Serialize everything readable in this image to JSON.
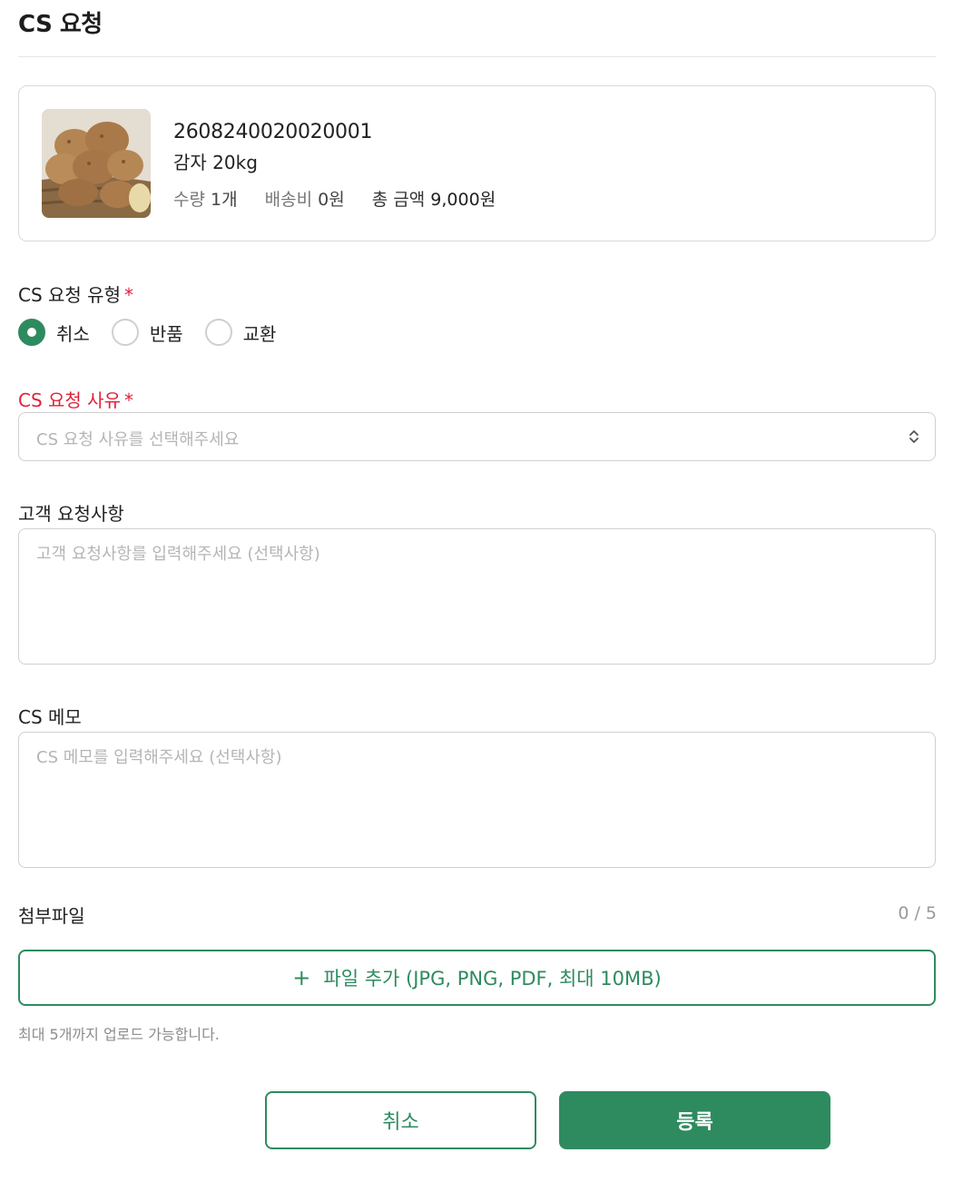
{
  "header": {
    "title": "CS 요청"
  },
  "product": {
    "code": "2608240020020001",
    "name": "감자 20kg",
    "quantity_label": "수량",
    "quantity_value": "1개",
    "shipping_label": "배송비",
    "shipping_value": "0원",
    "total_label": "총 금액",
    "total_value": "9,000원"
  },
  "form": {
    "type": {
      "label": "CS 요청 유형",
      "required_mark": "*",
      "options": [
        {
          "label": "취소",
          "checked": true
        },
        {
          "label": "반품",
          "checked": false
        },
        {
          "label": "교환",
          "checked": false
        }
      ]
    },
    "reason": {
      "label": "CS 요청 사유",
      "required_mark": "*",
      "placeholder": "CS 요청 사유를 선택해주세요"
    },
    "customer_request": {
      "label": "고객 요청사항",
      "placeholder": "고객 요청사항를 입력해주세요 (선택사항)"
    },
    "memo": {
      "label": "CS 메모",
      "placeholder": "CS 메모를 입력해주세요 (선택사항)"
    },
    "attachments": {
      "label": "첨부파일",
      "count": "0 / 5",
      "add_button_icon": "+",
      "add_button_label": "파일 추가 (JPG, PNG, PDF, 최대 10MB)",
      "helper": "최대 5개까지 업로드 가능합니다."
    }
  },
  "actions": {
    "cancel_label": "취소",
    "submit_label": "등록"
  },
  "colors": {
    "accent": "#2e8b5f",
    "required": "#e0213a",
    "border": "#d0d0d0",
    "placeholder": "#b5b5b5"
  },
  "icons": {
    "thumbnail": "potato-basket-image",
    "select": "updown-chevron-icon",
    "radio_selected": "radio-checked-icon"
  }
}
